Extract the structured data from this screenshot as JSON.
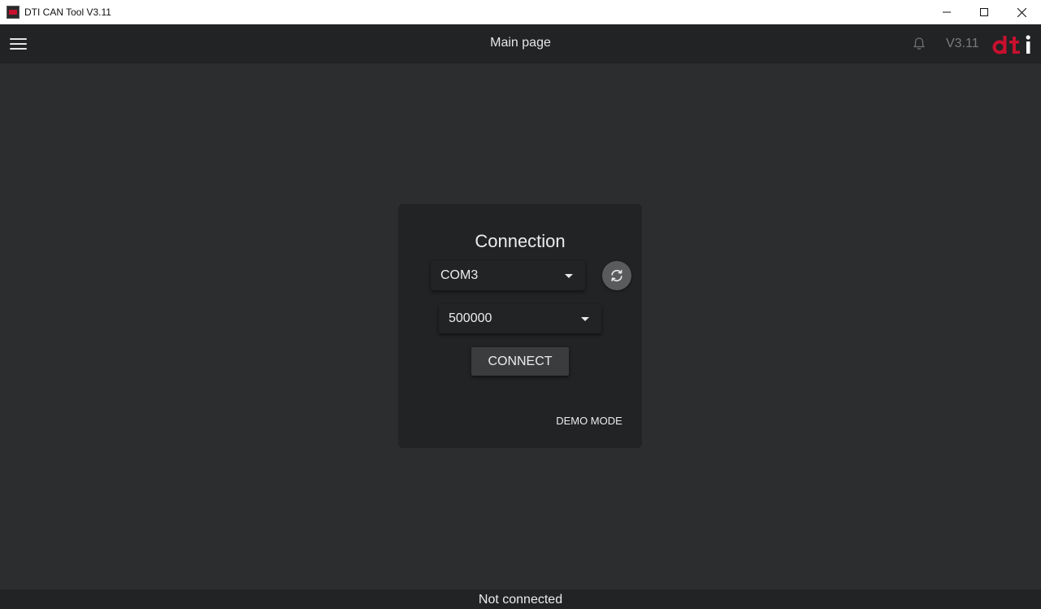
{
  "window": {
    "title": "DTI CAN Tool V3.11"
  },
  "header": {
    "title": "Main page",
    "version": "V3.11",
    "logo_text": "dti"
  },
  "connection": {
    "title": "Connection",
    "port": {
      "value": "COM3"
    },
    "baud": {
      "value": "500000"
    },
    "connect_label": "CONNECT",
    "demo_label": "DEMO MODE"
  },
  "status": {
    "text": "Not connected"
  },
  "icons": {
    "menu": "hamburger-icon",
    "bell": "bell-icon",
    "refresh": "refresh-icon",
    "dropdown": "caret-down-icon"
  },
  "colors": {
    "brand_red": "#c8102e",
    "background": "#2c2d2f",
    "surface": "#222325",
    "text": "#ececec",
    "muted": "#7a7b7e"
  }
}
